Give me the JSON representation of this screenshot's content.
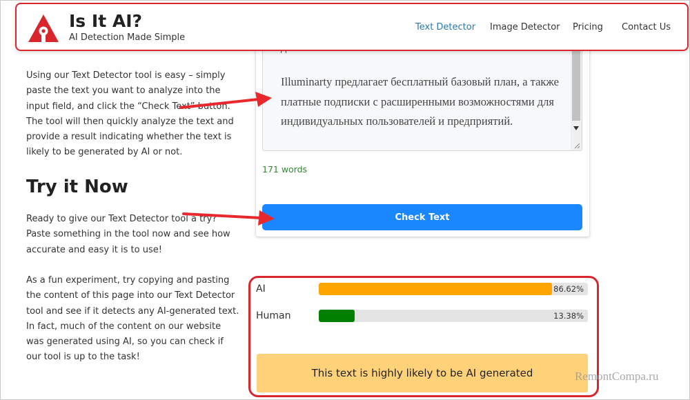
{
  "header": {
    "brand_title": "Is It AI?",
    "brand_subtitle": "AI Detection Made Simple",
    "nav": [
      "Text Detector",
      "Image Detector",
      "Pricing",
      "Contact Us"
    ],
    "active_nav": "Text Detector"
  },
  "left": {
    "intro": "Using our Text Detector tool is easy – simply paste the text you want to analyze into the input field, and click the “Check Text” button. The tool will then quickly analyze the text and provide a result indicating whether the text is likely to be generated by AI or not.",
    "heading": "Try it Now",
    "try_text": "Ready to give our Text Detector tool a try? Paste something in the tool now and see how accurate and easy it is to use!",
    "experiment": "As a fun experiment, try copying and pasting the content of this page into our Text Detector tool and see if it detects any AI-generated text. In fact, much of the content on our website was generated using AI, so you can check if our tool is up to the task!"
  },
  "tool": {
    "textarea_prev_line": "для автоматического анализа контента.",
    "textarea_text": "Illuminarty предлагает бесплатный базовый план, а также платные подписки с расширенными возможностями для индивидуальных пользователей и предприятий.",
    "word_count": "171 words",
    "check_button": "Check Text"
  },
  "result": {
    "ai_label": "AI",
    "ai_fraction": 0.8662,
    "ai_percent": "86.62%",
    "human_label": "Human",
    "human_fraction": 0.1338,
    "human_percent": "13.38%",
    "verdict": "This text is highly likely to be AI generated"
  },
  "colors": {
    "brand_red": "#d8262c",
    "nav_active": "#2a7ab0",
    "button_blue": "#1a86ff",
    "ai_bar": "#ffa500",
    "human_bar": "#008000",
    "verdict_bg": "#ffd27a",
    "word_count_green": "#2e8b2e"
  },
  "watermark": "RemontCompa.ru"
}
